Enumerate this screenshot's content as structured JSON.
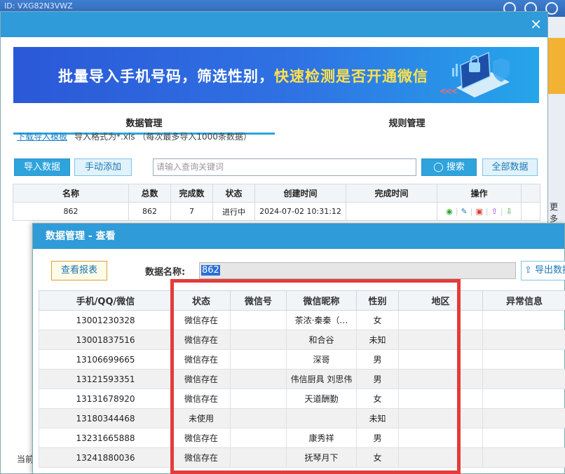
{
  "desktop": {
    "top_id": "ID: VXG82N3VWZ",
    "more_text": "更多"
  },
  "main_window": {
    "close_label": "×",
    "banner": {
      "text_part1": "批量导入手机号码，筛选性别，",
      "text_highlight": "快速检测是否开通微信"
    },
    "tabs": [
      {
        "label": "数据管理",
        "active": true
      },
      {
        "label": "规则管理",
        "active": false
      }
    ],
    "download_template_link": "下载导入模板",
    "format_hint": "导入格式为*.xls （每次最多导入1000条数据）",
    "buttons": {
      "import": "导入数据",
      "manual_add": "手动添加",
      "search": "搜索",
      "all_data": "全部数据"
    },
    "search_placeholder": "请输入查询关键词",
    "table": {
      "headers": [
        "名称",
        "总数",
        "完成数",
        "状态",
        "创建时间",
        "完成时间",
        "操作"
      ],
      "rows": [
        {
          "name": "862",
          "total": "862",
          "done": "7",
          "status": "进行中",
          "created": "2024-07-02 10:31:12",
          "finished": ""
        }
      ]
    },
    "bottom_text": "当前"
  },
  "dialog": {
    "title": "数据管理 - 查看",
    "report_button": "查看报表",
    "data_name_label": "数据名称:",
    "data_name_value": "862",
    "export_button": "导出数据",
    "table": {
      "headers": [
        "手机/QQ/微信",
        "状态",
        "微信号",
        "微信昵称",
        "性别",
        "地区",
        "异常信息"
      ],
      "rows": [
        {
          "phone": "13001230328",
          "status": "微信存在",
          "wxid": "",
          "nickname": "茶浓·秦秦（…",
          "gender": "女",
          "region": "",
          "error": ""
        },
        {
          "phone": "13001837516",
          "status": "微信存在",
          "wxid": "",
          "nickname": "和合谷",
          "gender": "未知",
          "region": "",
          "error": ""
        },
        {
          "phone": "13106699665",
          "status": "微信存在",
          "wxid": "",
          "nickname": "深哥",
          "gender": "男",
          "region": "",
          "error": ""
        },
        {
          "phone": "13121593351",
          "status": "微信存在",
          "wxid": "",
          "nickname": "伟信厨具 刘思伟",
          "gender": "男",
          "region": "",
          "error": ""
        },
        {
          "phone": "13131678920",
          "status": "微信存在",
          "wxid": "",
          "nickname": "天道酬勤",
          "gender": "女",
          "region": "",
          "error": ""
        },
        {
          "phone": "13180344468",
          "status": "未使用",
          "wxid": "",
          "nickname": "",
          "gender": "未知",
          "region": "",
          "error": ""
        },
        {
          "phone": "13231665888",
          "status": "微信存在",
          "wxid": "",
          "nickname": "康秀祥",
          "gender": "男",
          "region": "",
          "error": ""
        },
        {
          "phone": "13241880036",
          "status": "微信存在",
          "wxid": "",
          "nickname": "抚琴月下",
          "gender": "女",
          "region": "",
          "error": ""
        }
      ]
    }
  },
  "colors": {
    "title_bar": "#2f9bd8",
    "highlight_box": "#e23c3c",
    "banner_highlight": "#ffe14d"
  }
}
